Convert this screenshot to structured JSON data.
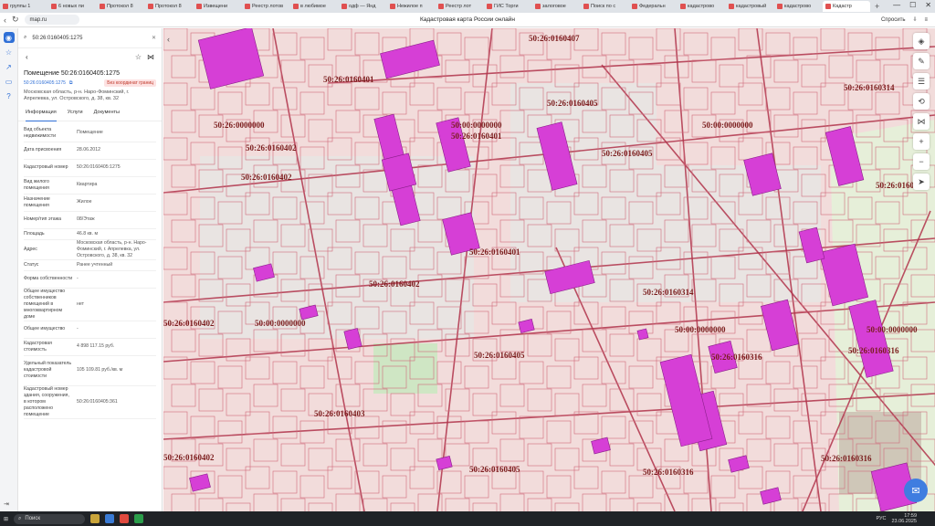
{
  "browser": {
    "tabs": [
      {
        "label": "группы 1"
      },
      {
        "label": "6 новых пи"
      },
      {
        "label": "Протокол 8"
      },
      {
        "label": "Протокол 8"
      },
      {
        "label": "Извещени"
      },
      {
        "label": "Реестр лотов"
      },
      {
        "label": "в любимое"
      },
      {
        "label": "одф — Янд"
      },
      {
        "label": "Нежилое п"
      },
      {
        "label": "Реестр лот"
      },
      {
        "label": "ГИС Торги"
      },
      {
        "label": "залоговое"
      },
      {
        "label": "Поиск по с"
      },
      {
        "label": "Федеральн"
      },
      {
        "label": "кадастрово"
      },
      {
        "label": "кадастровый"
      },
      {
        "label": "кадастрово"
      },
      {
        "label": "Кадастр"
      }
    ],
    "url": "map.ru",
    "page_title": "Кадастровая карта России онлайн",
    "ask_label": "Спросить"
  },
  "panel": {
    "search_value": "50:26:0160405:1275",
    "title": "Помещение 50:26:0160405:1275",
    "cad_link": "50:26:0160405:1275",
    "warning": "Без координат границ",
    "address": "Московская область, р-н. Наро-Фоминский, г. Апрелевка, ул. Островского, д. 38, кв. 32",
    "tabs": [
      "Информация",
      "Услуги",
      "Документы"
    ],
    "props": [
      {
        "k": "Вид объекта недвижимости",
        "v": "Помещение"
      },
      {
        "k": "Дата присвоения",
        "v": "28.06.2012"
      },
      {
        "k": "Кадастровый номер",
        "v": "50:26:0160405:1275"
      },
      {
        "k": "Вид жилого помещения",
        "v": "Квартира"
      },
      {
        "k": "Назначение помещения",
        "v": "Жилое"
      },
      {
        "k": "Номер/тип этажа",
        "v": "08/Этаж"
      },
      {
        "k": "Площадь",
        "v": "46.8 кв. м"
      },
      {
        "k": "Адрес",
        "v": "Московская область, р-н. Наро-Фоминский, г. Апрелевка, ул. Островского, д. 38, кв. 32"
      },
      {
        "k": "Статус",
        "v": "Ранее учтенный"
      },
      {
        "k": "Форма собственности",
        "v": "-"
      },
      {
        "k": "Общее имущество собственников помещений в многоквартирном доме",
        "v": "нет"
      },
      {
        "k": "Общее имущество",
        "v": "-"
      },
      {
        "k": "Кадастровая стоимость",
        "v": "4 898 117.15 руб."
      },
      {
        "k": "Удельный показатель кадастровой стоимости",
        "v": "105 109.81 руб./кв. м"
      },
      {
        "k": "Кадастровый номер здания, сооружения, в котором расположено помещение",
        "v": "50:26:0160405:361"
      }
    ]
  },
  "map": {
    "labels": [
      {
        "t": "50:26:0160407"
      },
      {
        "t": "50:26:0160401"
      },
      {
        "t": "50:26:0000000"
      },
      {
        "t": "50:26:0160402"
      },
      {
        "t": "50:00:0000000"
      },
      {
        "t": "50:26:0160401"
      },
      {
        "t": "50:26:0160405"
      },
      {
        "t": "50:26:0160405"
      },
      {
        "t": "50:26:0160314"
      },
      {
        "t": "50:00:0000000"
      },
      {
        "t": "50:26:0160317"
      },
      {
        "t": "50:26:0160401"
      },
      {
        "t": "50:26:0160314"
      },
      {
        "t": "50:26:0160402"
      },
      {
        "t": "50:00:0000000"
      },
      {
        "t": "50:00:0000000"
      },
      {
        "t": "50:26:0160405"
      },
      {
        "t": "50:26:0160316"
      },
      {
        "t": "50:26:0160316"
      },
      {
        "t": "50:00:0000000"
      },
      {
        "t": "50:26:0160403"
      },
      {
        "t": "50:26:0160402"
      },
      {
        "t": "50:26:0160405"
      },
      {
        "t": "50:26:0160316"
      },
      {
        "t": "50:26:0160316"
      },
      {
        "t": "50:26:0160402"
      },
      {
        "t": "50:26:0160402"
      }
    ],
    "attribution": [
      "Yandex",
      "Карты © Яндекс",
      "Условия использования"
    ]
  },
  "taskbar": {
    "search": "Поиск",
    "lang": "РУС",
    "time": "17:59",
    "date": "23.06.2025"
  }
}
